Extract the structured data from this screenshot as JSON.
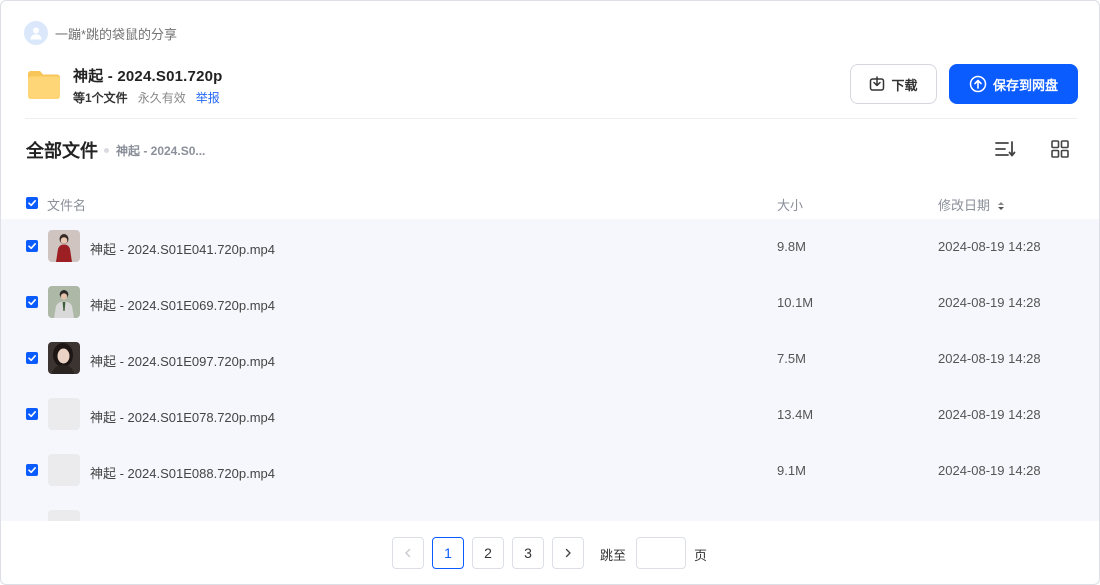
{
  "sharer": {
    "name": "一蹦*跳的袋鼠的分享",
    "avatar_icon": "user-avatar-icon"
  },
  "share": {
    "title": "神起 - 2024.S01.720p",
    "file_count": "等1个文件",
    "validity": "永久有效",
    "report_label": "举报"
  },
  "actions": {
    "download_label": "下载",
    "save_label": "保存到网盘",
    "accent_color": "#0b5cff"
  },
  "breadcrumb": {
    "root": "全部文件",
    "current": "神起 - 2024.S0..."
  },
  "table": {
    "columns": {
      "name": "文件名",
      "size": "大小",
      "modified": "修改日期"
    },
    "all_selected": true,
    "rows": [
      {
        "name": "神起 - 2024.S01E041.720p.mp4",
        "size": "9.8M",
        "modified": "2024-08-19 14:28",
        "checked": true,
        "thumb": "video-thumbnail-woman-red-dress"
      },
      {
        "name": "神起 - 2024.S01E069.720p.mp4",
        "size": "10.1M",
        "modified": "2024-08-19 14:28",
        "checked": true,
        "thumb": "video-thumbnail-man-suit"
      },
      {
        "name": "神起 - 2024.S01E097.720p.mp4",
        "size": "7.5M",
        "modified": "2024-08-19 14:28",
        "checked": true,
        "thumb": "video-thumbnail-woman-portrait"
      },
      {
        "name": "神起 - 2024.S01E078.720p.mp4",
        "size": "13.4M",
        "modified": "2024-08-19 14:28",
        "checked": true,
        "thumb": "placeholder"
      },
      {
        "name": "神起 - 2024.S01E088.720p.mp4",
        "size": "9.1M",
        "modified": "2024-08-19 14:28",
        "checked": true,
        "thumb": "placeholder"
      }
    ]
  },
  "pagination": {
    "pages": [
      "1",
      "2",
      "3"
    ],
    "current": "1",
    "jump_label": "跳至",
    "jump_value": "",
    "page_unit": "页"
  }
}
